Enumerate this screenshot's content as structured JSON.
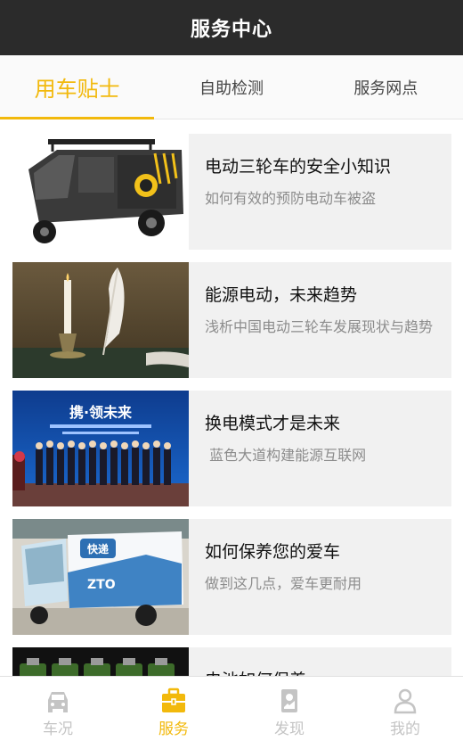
{
  "header": {
    "title": "服务中心"
  },
  "tabs": [
    {
      "label": "用车贴士",
      "active": true
    },
    {
      "label": "自助检测",
      "active": false
    },
    {
      "label": "服务网点",
      "active": false
    }
  ],
  "articles": [
    {
      "title": "电动三轮车的安全小知识",
      "summary": "如何有效的预防电动车被盗",
      "image": "electric-tricycle-photo"
    },
    {
      "title": "能源电动，未来趋势",
      "summary": "浅析中国电动三轮车发展现状与趋势",
      "image": "quill-and-candle-photo"
    },
    {
      "title": "换电模式才是未来",
      "summary": " 蓝色大道构建能源互联网",
      "image": "conference-group-photo",
      "banner_text": "携·领未来"
    },
    {
      "title": "如何保养您的爱车",
      "summary": "做到这几点，爱车更耐用",
      "image": "delivery-tricycle-photo",
      "badge_text": "快递",
      "brand_text": "ZTO"
    },
    {
      "title": "电池如何保养",
      "summary": "",
      "image": "battery-row-photo"
    }
  ],
  "tabbar": [
    {
      "label": "车况",
      "icon": "car-icon",
      "active": false
    },
    {
      "label": "服务",
      "icon": "briefcase-icon",
      "active": true
    },
    {
      "label": "发现",
      "icon": "discover-icon",
      "active": false
    },
    {
      "label": "我的",
      "icon": "person-icon",
      "active": false
    }
  ],
  "colors": {
    "accent": "#f2b90c",
    "header_bg": "#2b2b2b",
    "card_bg": "#f1f1f1"
  }
}
